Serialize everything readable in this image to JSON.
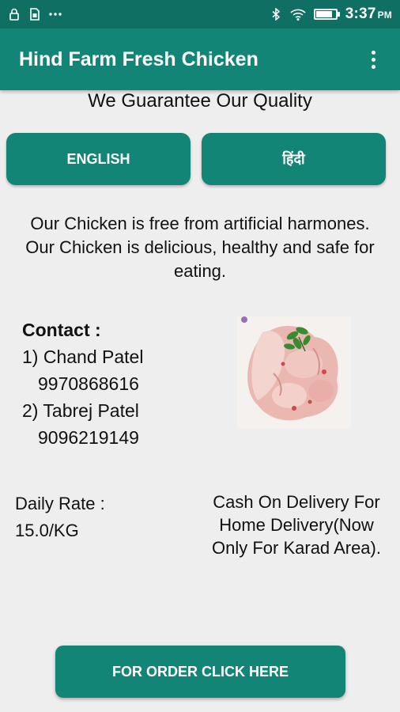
{
  "status_bar": {
    "time": "3:37",
    "ampm": "PM",
    "left_icons": [
      "lock-icon",
      "sim-card-icon",
      "more-notifications-icon"
    ],
    "right_icons": [
      "bluetooth-icon",
      "wifi-icon",
      "battery-icon"
    ],
    "battery_level": 0.85
  },
  "app_bar": {
    "title": "Hind Farm Fresh Chicken",
    "menu_icon": "overflow-menu-icon"
  },
  "headline": "We Guarantee Our Quality",
  "language_buttons": {
    "english": "ENGLISH",
    "hindi": "हिंदी"
  },
  "description": "Our Chicken is free from artificial harmones. Our Chicken is delicious, healthy and safe for eating.",
  "contact": {
    "heading": "Contact :",
    "person1_name": "1) Chand Patel",
    "person1_phone": "9970868616",
    "person2_name": "2) Tabrej Patel",
    "person2_phone": "9096219149"
  },
  "rate": {
    "label": "Daily Rate :",
    "value": "15.0/KG"
  },
  "delivery_note": "Cash On Delivery For Home Delivery(Now Only For Karad Area).",
  "order_button": "FOR ORDER CLICK HERE",
  "colors": {
    "primary": "#138576",
    "primary_dark": "#0f6f63",
    "background": "#eeeeee"
  }
}
